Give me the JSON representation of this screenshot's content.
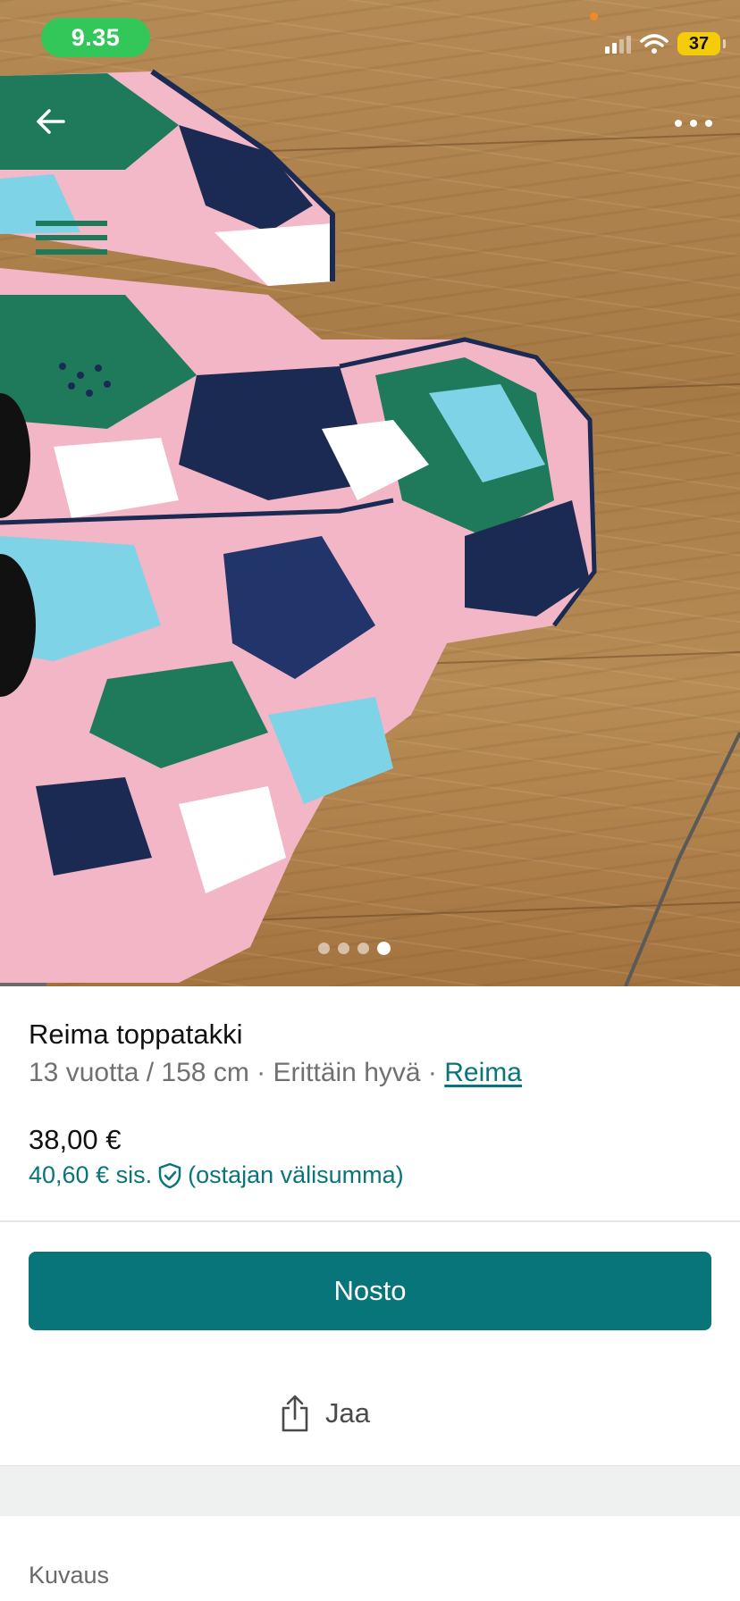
{
  "status_bar": {
    "time": "9.35",
    "battery": "37"
  },
  "nav": {
    "back_icon": "arrow-left-icon",
    "more_icon": "more-horizontal-icon"
  },
  "gallery": {
    "current_index": 4,
    "total": 4
  },
  "item": {
    "title": "Reima toppatakki",
    "size": "13 vuotta / 158 cm",
    "separator": "·",
    "condition": "Erittäin hyvä",
    "brand": "Reima",
    "price": "38,00 €",
    "price_with_protection": "40,60 € sis.",
    "protection_note": "(ostajan välisumma)",
    "protection_icon": "shield-check-icon"
  },
  "actions": {
    "primary_label": "Nosto",
    "share_label": "Jaa",
    "share_icon": "share-icon"
  },
  "sections": {
    "description_label": "Kuvaus"
  },
  "colors": {
    "accent": "#08757b",
    "status_green": "#33c759",
    "battery_yellow": "#f5cc0a"
  }
}
